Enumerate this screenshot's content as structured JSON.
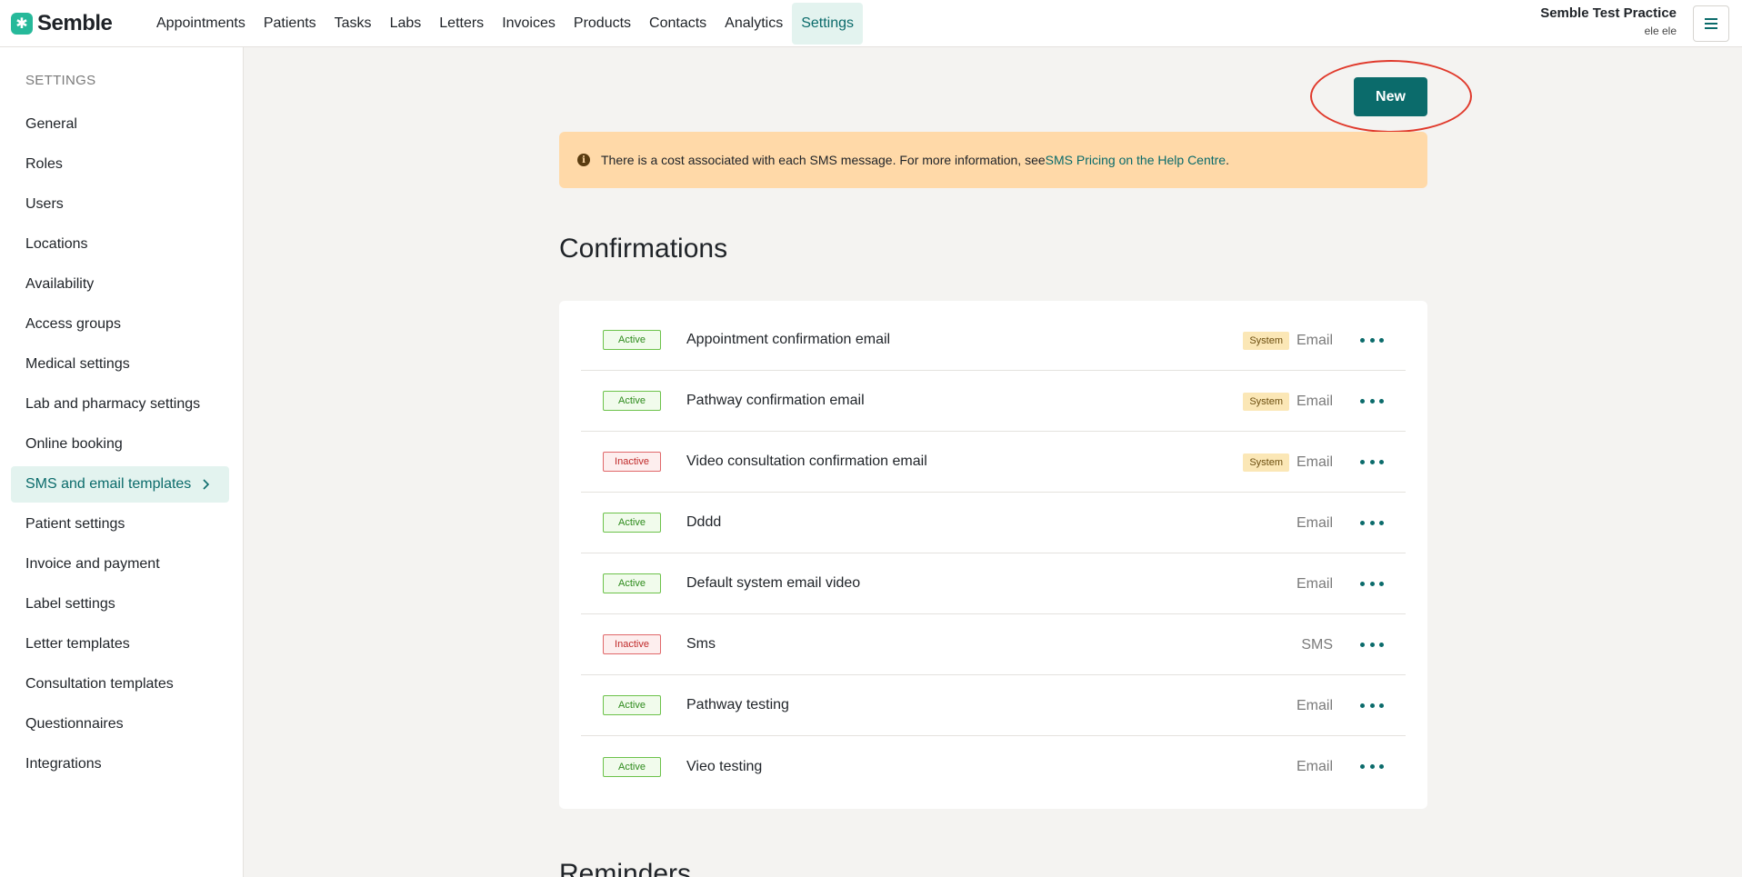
{
  "header": {
    "logo_text": "Semble",
    "nav": [
      "Appointments",
      "Patients",
      "Tasks",
      "Labs",
      "Letters",
      "Invoices",
      "Products",
      "Contacts",
      "Analytics",
      "Settings"
    ],
    "active_nav": "Settings",
    "practice_name": "Semble Test Practice",
    "user_name": "ele ele"
  },
  "sidebar": {
    "heading": "SETTINGS",
    "items": [
      {
        "label": "General"
      },
      {
        "label": "Roles"
      },
      {
        "label": "Users"
      },
      {
        "label": "Locations"
      },
      {
        "label": "Availability"
      },
      {
        "label": "Access groups"
      },
      {
        "label": "Medical settings"
      },
      {
        "label": "Lab and pharmacy settings"
      },
      {
        "label": "Online booking"
      },
      {
        "label": "SMS and email templates"
      },
      {
        "label": "Patient settings"
      },
      {
        "label": "Invoice and payment"
      },
      {
        "label": "Label settings"
      },
      {
        "label": "Letter templates"
      },
      {
        "label": "Consultation templates"
      },
      {
        "label": "Questionnaires"
      },
      {
        "label": "Integrations"
      }
    ],
    "active_item": "SMS and email templates"
  },
  "main": {
    "new_button_label": "New",
    "notice": {
      "text": "There is a cost associated with each SMS message. For more information, see ",
      "link_text": "SMS Pricing on the Help Centre",
      "suffix": "."
    },
    "confirmations_title": "Confirmations",
    "reminders_title": "Reminders",
    "rows": [
      {
        "status": "Active",
        "name": "Appointment confirmation email",
        "system": "System",
        "channel": "Email"
      },
      {
        "status": "Active",
        "name": "Pathway confirmation email",
        "system": "System",
        "channel": "Email"
      },
      {
        "status": "Inactive",
        "name": "Video consultation confirmation email",
        "system": "System",
        "channel": "Email"
      },
      {
        "status": "Active",
        "name": "Dddd",
        "system": "",
        "channel": "Email"
      },
      {
        "status": "Active",
        "name": "Default system email video",
        "system": "",
        "channel": "Email"
      },
      {
        "status": "Inactive",
        "name": "Sms",
        "system": "",
        "channel": "SMS"
      },
      {
        "status": "Active",
        "name": "Pathway testing",
        "system": "",
        "channel": "Email"
      },
      {
        "status": "Active",
        "name": "Vieo testing",
        "system": "",
        "channel": "Email"
      }
    ]
  },
  "colors": {
    "brand": "#0b6b6b",
    "accent_green": "#26b99a",
    "notice_bg": "#ffd9a8",
    "highlight_ring": "#e0392b"
  }
}
